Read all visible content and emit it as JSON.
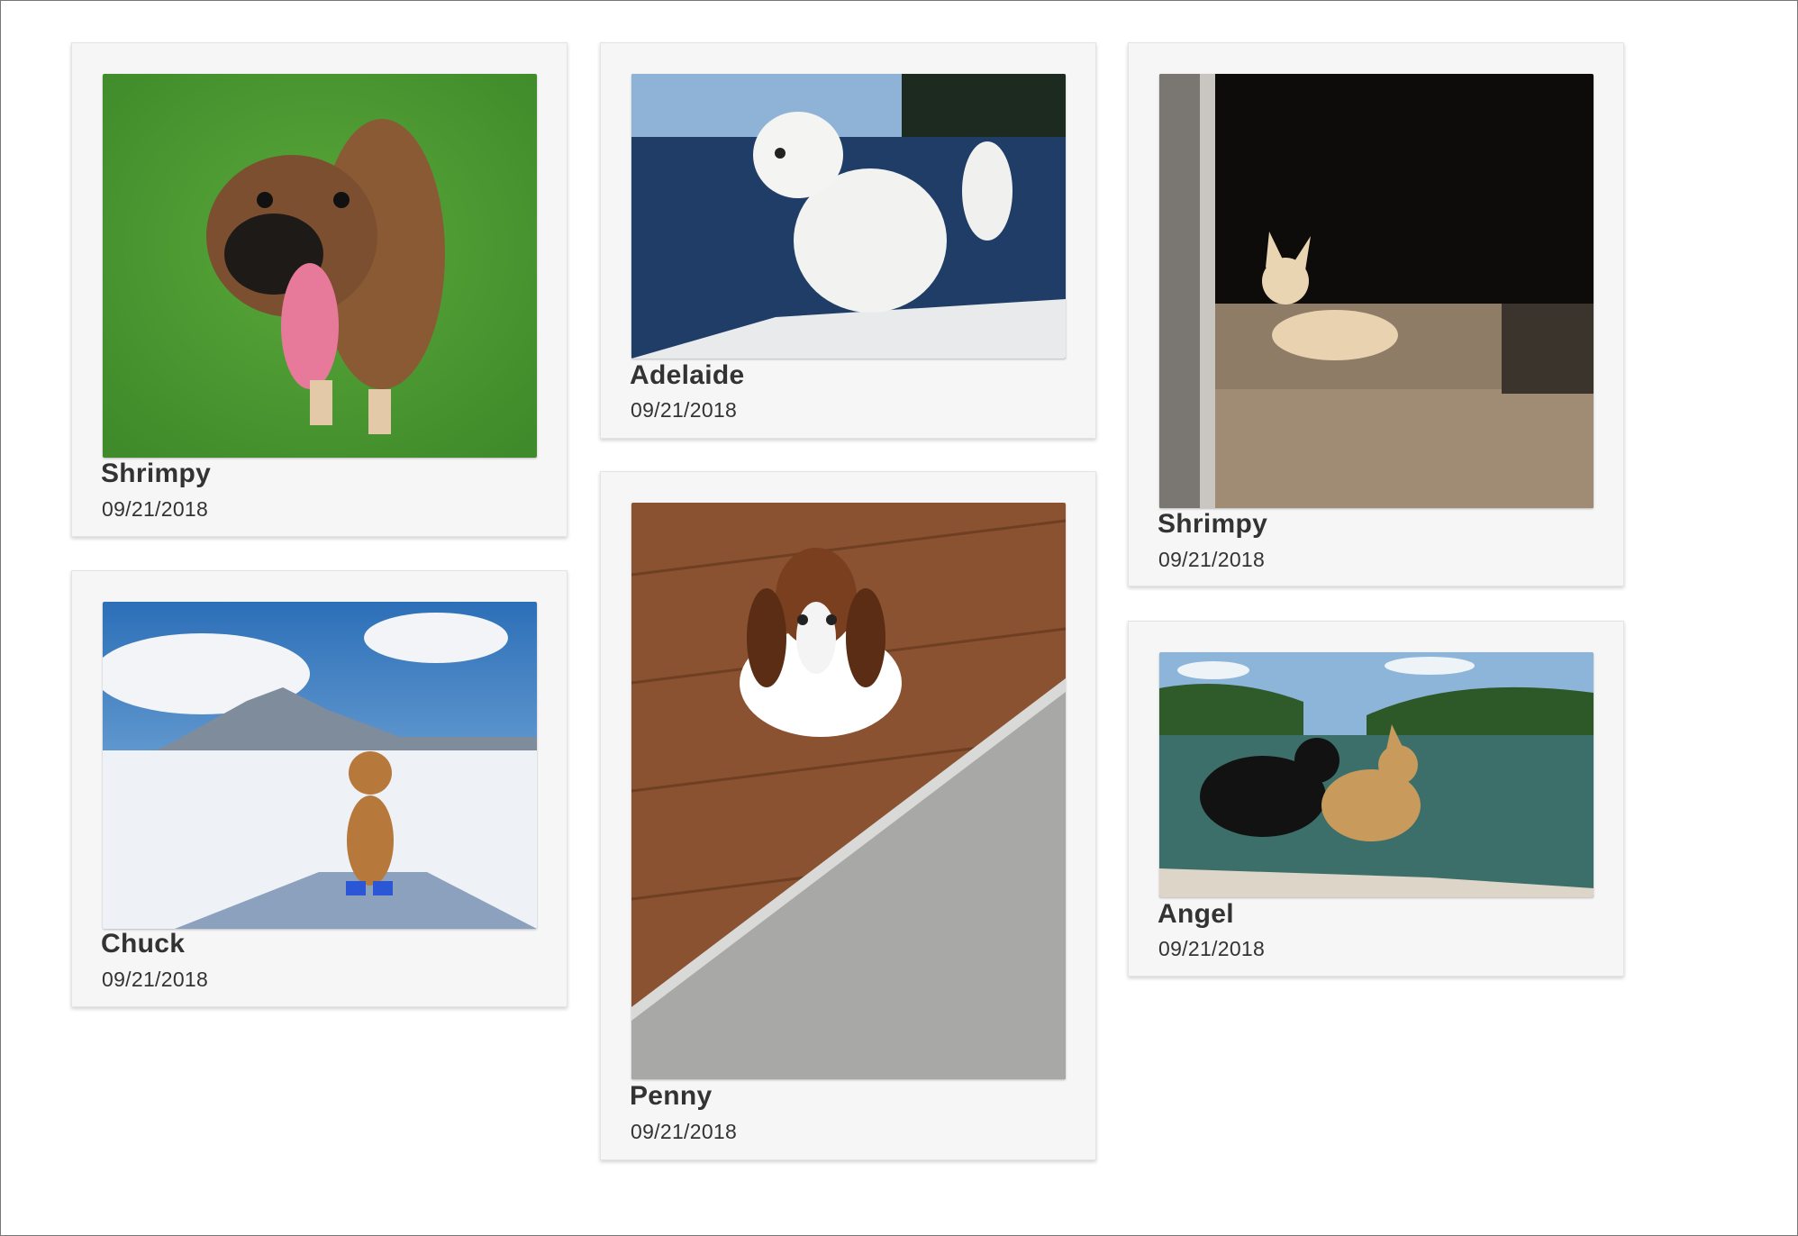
{
  "cards": [
    {
      "name": "Shrimpy",
      "date": "09/21/2018",
      "photo_icon": "boxer-dog-on-grass-photo"
    },
    {
      "name": "Chuck",
      "date": "09/21/2018",
      "photo_icon": "dog-in-snow-photo"
    },
    {
      "name": "Adelaide",
      "date": "09/21/2018",
      "photo_icon": "white-dog-on-boat-photo"
    },
    {
      "name": "Penny",
      "date": "09/21/2018",
      "photo_icon": "basset-hound-on-floor-photo"
    },
    {
      "name": "Shrimpy",
      "date": "09/21/2018",
      "photo_icon": "chihuahua-on-stairs-photo"
    },
    {
      "name": "Angel",
      "date": "09/21/2018",
      "photo_icon": "two-dogs-on-boat-photo"
    }
  ]
}
